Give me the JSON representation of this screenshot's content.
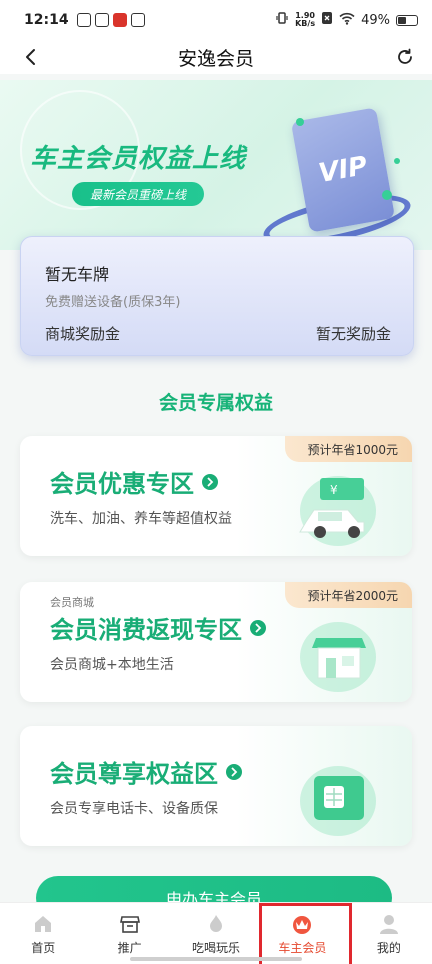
{
  "status_bar": {
    "time": "12:14",
    "speed_value": "1.90",
    "speed_unit": "KB/s",
    "battery": "49%",
    "battery_level": 0.49
  },
  "header": {
    "title": "安逸会员"
  },
  "banner": {
    "title": "车主会员权益上线",
    "subtitle": "最新会员重磅上线",
    "vip_text": "VIP"
  },
  "plate_card": {
    "title": "暂无车牌",
    "subtitle": "免费赠送设备(质保3年)",
    "left_label": "商城奖励金",
    "right_label": "暂无奖励金"
  },
  "section_title": "会员专属权益",
  "benefits": [
    {
      "tag": "预计年省1000元",
      "title": "会员优惠专区",
      "desc": "洗车、加油、养车等超值权益"
    },
    {
      "small": "会员商城",
      "tag": "预计年省2000元",
      "title": "会员消费返现专区",
      "desc": "会员商城+本地生活"
    },
    {
      "title": "会员尊享权益区",
      "desc": "会员专享电话卡、设备质保"
    }
  ],
  "apply_button": "申办车主会员",
  "tabs": [
    {
      "label": "首页",
      "icon": "home-icon"
    },
    {
      "label": "推广",
      "icon": "store-icon"
    },
    {
      "label": "吃喝玩乐",
      "icon": "flame-icon"
    },
    {
      "label": "车主会员",
      "icon": "crown-icon",
      "active": true
    },
    {
      "label": "我的",
      "icon": "user-icon"
    }
  ],
  "colors": {
    "accent": "#19ad76",
    "active_tab": "#e5492f",
    "highlight_box": "#e0282e"
  }
}
